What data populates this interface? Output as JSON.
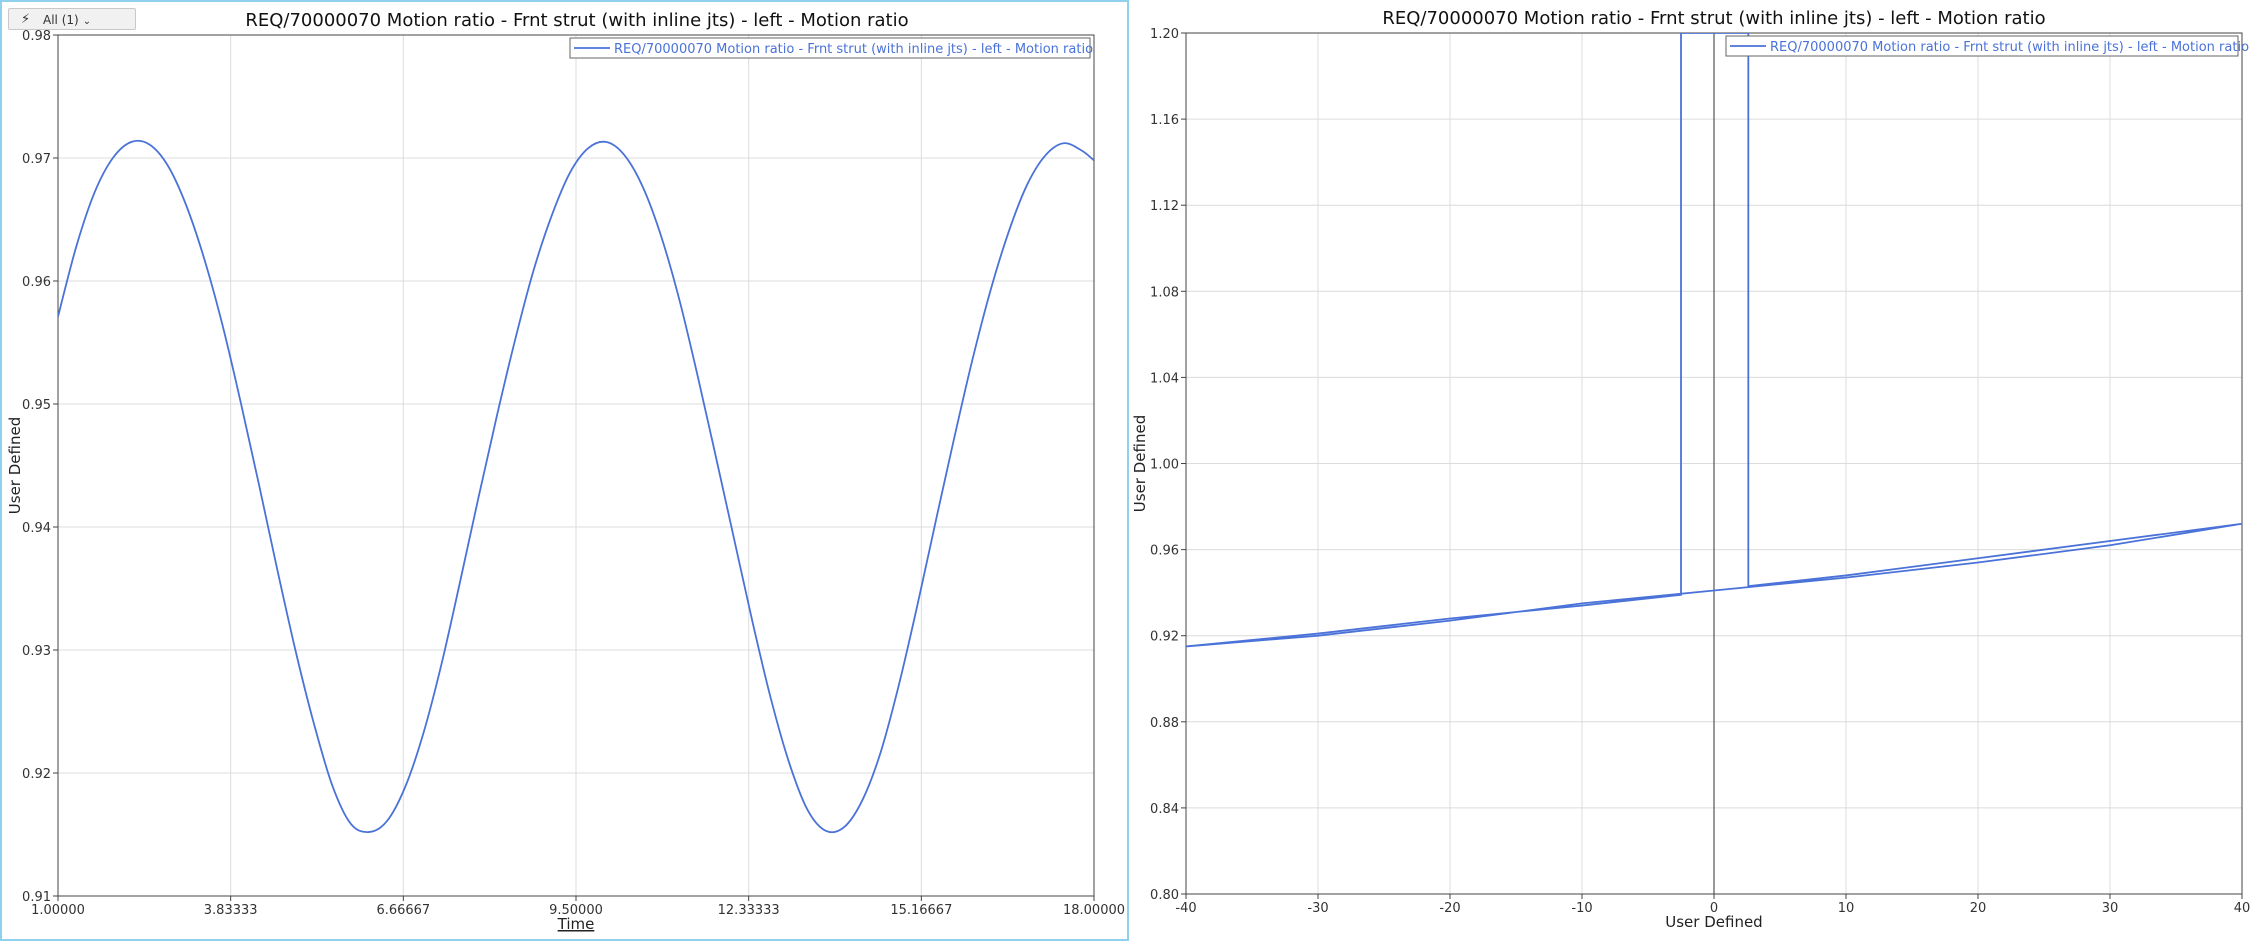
{
  "filter_button": {
    "label": "All (1)",
    "icon": "lightning-icon"
  },
  "colors": {
    "series": "#4a72d8",
    "grid": "#dcdcdc",
    "axis": "#444444",
    "zero_line": "#555555"
  },
  "chart_data": [
    {
      "type": "line",
      "title": "REQ/70000070 Motion ratio - Frnt strut (with inline jts) - left - Motion ratio",
      "xlabel": "Time",
      "ylabel": "User Defined",
      "xlim": [
        1.0,
        18.0
      ],
      "ylim": [
        0.91,
        0.98
      ],
      "xticks": [
        "1.00000",
        "3.83333",
        "6.66667",
        "9.50000",
        "12.33333",
        "15.16667",
        "18.00000"
      ],
      "yticks": [
        "0.91",
        "0.92",
        "0.93",
        "0.94",
        "0.95",
        "0.96",
        "0.97",
        "0.98"
      ],
      "grid": true,
      "legend_position": "top-right",
      "series": [
        {
          "name": "REQ/70000070 Motion ratio - Frnt strut (with inline jts) - left - Motion ratio",
          "x": [
            1.0,
            1.3,
            1.6,
            1.9,
            2.2,
            2.5,
            2.8,
            3.1,
            3.4,
            3.7,
            4.0,
            4.3,
            4.6,
            4.9,
            5.2,
            5.5,
            5.8,
            6.1,
            6.4,
            6.7,
            7.0,
            7.3,
            7.6,
            7.9,
            8.2,
            8.5,
            8.8,
            9.1,
            9.4,
            9.7,
            10.0,
            10.3,
            10.6,
            10.9,
            11.2,
            11.5,
            11.8,
            12.1,
            12.4,
            12.7,
            13.0,
            13.3,
            13.6,
            13.9,
            14.2,
            14.5,
            14.8,
            15.1,
            15.4,
            15.7,
            16.0,
            16.3,
            16.6,
            16.9,
            17.2,
            17.5,
            17.8,
            18.0
          ],
          "y": [
            0.9571,
            0.9628,
            0.9672,
            0.97,
            0.9713,
            0.9711,
            0.9694,
            0.9662,
            0.9618,
            0.9564,
            0.9501,
            0.9434,
            0.9365,
            0.9299,
            0.924,
            0.919,
            0.9159,
            0.9152,
            0.9161,
            0.9189,
            0.9233,
            0.929,
            0.9356,
            0.9424,
            0.949,
            0.9552,
            0.9608,
            0.9653,
            0.9688,
            0.9708,
            0.9713,
            0.9702,
            0.9676,
            0.9636,
            0.9584,
            0.9522,
            0.9456,
            0.9389,
            0.9322,
            0.926,
            0.9208,
            0.917,
            0.9153,
            0.9156,
            0.9178,
            0.9217,
            0.9272,
            0.9336,
            0.9404,
            0.9471,
            0.9535,
            0.9592,
            0.964,
            0.9678,
            0.9702,
            0.9712,
            0.9706,
            0.9698
          ]
        }
      ]
    },
    {
      "type": "line",
      "title": "REQ/70000070 Motion ratio - Frnt strut (with inline jts) - left - Motion ratio",
      "xlabel": "User Defined",
      "ylabel": "User Defined",
      "xlim": [
        -40,
        40
      ],
      "ylim": [
        0.8,
        1.2
      ],
      "xticks": [
        "-40",
        "-30",
        "-20",
        "-10",
        "0",
        "10",
        "20",
        "30",
        "40"
      ],
      "yticks": [
        "0.80",
        "0.84",
        "0.88",
        "0.92",
        "0.96",
        "1.00",
        "1.04",
        "1.08",
        "1.12",
        "1.16",
        "1.20"
      ],
      "grid": true,
      "legend_position": "top-right",
      "series": [
        {
          "name": "REQ/70000070 Motion ratio - Frnt strut (with inline jts) - left - Motion ratio",
          "x": [
            -40,
            -30,
            -20,
            -10,
            -2.5,
            -2.5,
            2.6,
            2.6,
            10,
            20,
            30,
            40,
            30,
            20,
            10,
            0,
            -10,
            -20,
            -30,
            -40
          ],
          "y": [
            0.915,
            0.921,
            0.928,
            0.934,
            0.939,
            1.2,
            1.2,
            0.943,
            0.948,
            0.956,
            0.964,
            0.972,
            0.962,
            0.954,
            0.947,
            0.941,
            0.935,
            0.927,
            0.92,
            0.915
          ]
        }
      ]
    }
  ]
}
